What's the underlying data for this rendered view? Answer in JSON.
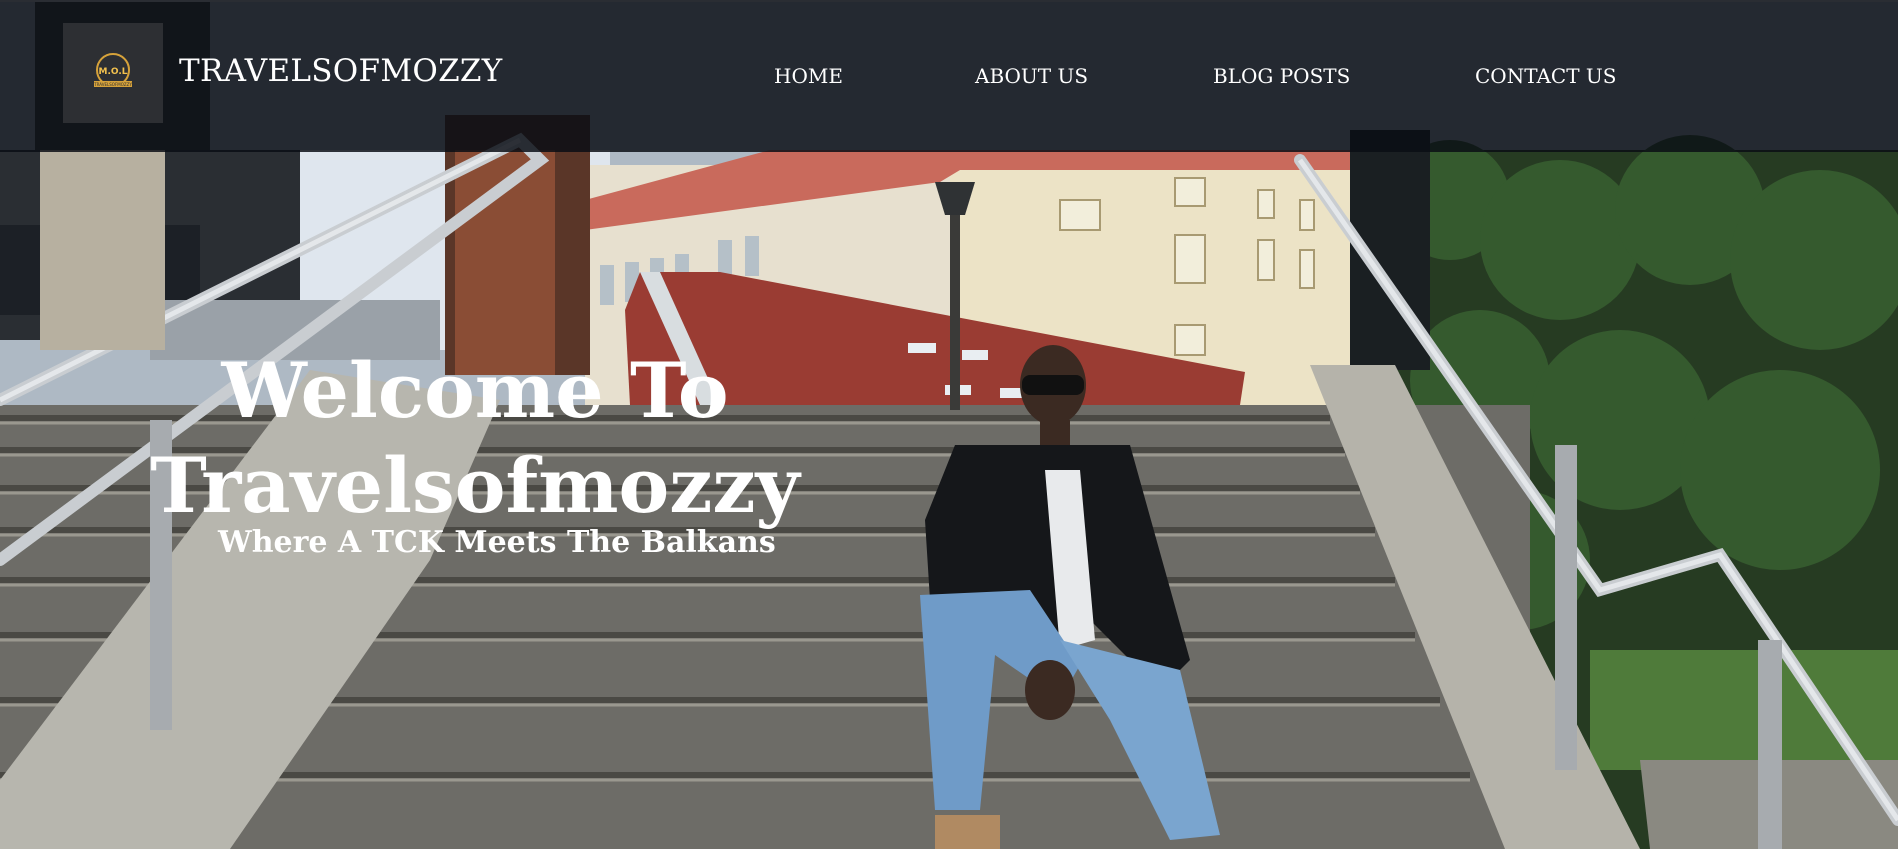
{
  "site": {
    "brand": "TRAVELSOFMOZZY",
    "logo": {
      "text": "M.O.L",
      "tagline": "TRAVELSOFMOZZY",
      "accent": "#d6a23a"
    }
  },
  "nav": {
    "items": [
      {
        "label": "HOME"
      },
      {
        "label": "ABOUT US"
      },
      {
        "label": "BLOG POSTS"
      },
      {
        "label": "CONTACT US"
      }
    ]
  },
  "hero": {
    "title_line1": "Welcome To",
    "title_line2": "Travelsofmozzy",
    "subtitle": "Where A TCK Meets The Balkans"
  },
  "colors": {
    "header_bg": "#0a0d14",
    "text": "#ffffff"
  }
}
